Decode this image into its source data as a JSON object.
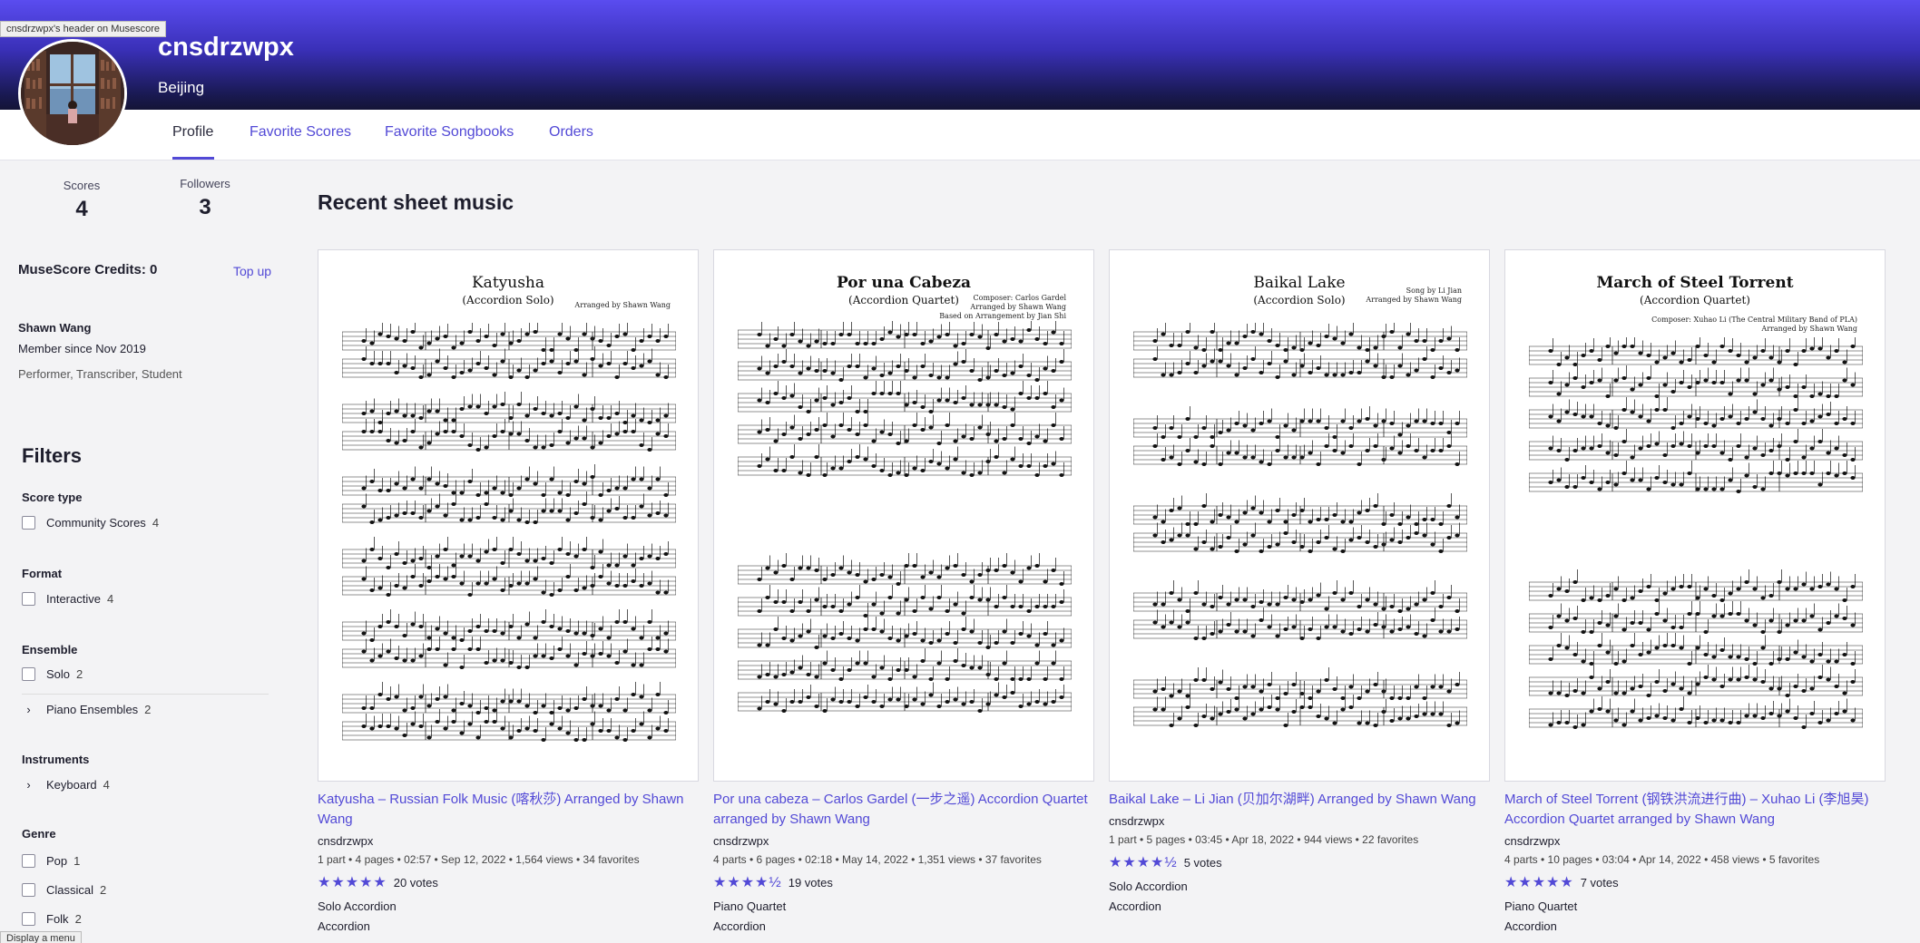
{
  "header": {
    "tooltip": "cnsdrzwpx's header on Musescore",
    "username": "cnsdrzwpx",
    "location": "Beijing"
  },
  "tabs": [
    {
      "label": "Profile"
    },
    {
      "label": "Favorite Scores"
    },
    {
      "label": "Favorite Songbooks"
    },
    {
      "label": "Orders"
    }
  ],
  "stats": {
    "scores_label": "Scores",
    "scores_value": "4",
    "followers_label": "Followers",
    "followers_value": "3"
  },
  "credits": {
    "label": "MuseScore Credits: 0",
    "topup": "Top up"
  },
  "profile": {
    "name": "Shawn Wang",
    "member_since": "Member since Nov 2019",
    "roles": "Performer, Transcriber, Student"
  },
  "filters": {
    "title": "Filters",
    "groups": [
      {
        "title": "Score type",
        "options": [
          {
            "label": "Community Scores",
            "count": "4"
          }
        ]
      },
      {
        "title": "Format",
        "options": [
          {
            "label": "Interactive",
            "count": "4"
          }
        ]
      },
      {
        "title": "Ensemble",
        "options": [
          {
            "label": "Solo",
            "count": "2"
          },
          {
            "label": "Piano Ensembles",
            "count": "2"
          }
        ]
      },
      {
        "title": "Instruments",
        "options": [
          {
            "label": "Keyboard",
            "count": "4"
          }
        ]
      },
      {
        "title": "Genre",
        "options": [
          {
            "label": "Pop",
            "count": "1"
          },
          {
            "label": "Classical",
            "count": "2"
          },
          {
            "label": "Folk",
            "count": "2"
          }
        ]
      }
    ]
  },
  "bottom_tip": "Display a menu",
  "main": {
    "title": "Recent sheet music",
    "cards": [
      {
        "sheet_title": "Katyusha",
        "sheet_sub": "(Accordion Solo)",
        "sheet_credit": "Arranged by Shawn Wang",
        "title": "Katyusha – Russian Folk Music (喀秋莎) Arranged by Shawn Wang",
        "author": "cnsdrzwpx",
        "meta": "1 part • 4 pages • 02:57 • Sep 12, 2022 • 1,564 views • 34 favorites",
        "stars": "★★★★★",
        "votes": "20 votes",
        "ensemble": "Solo Accordion",
        "instrument": "Accordion"
      },
      {
        "sheet_title": "Por una Cabeza",
        "sheet_sub": "(Accordion Quartet)",
        "sheet_credit": "Composer: Carlos Gardel\nArranged by Shawn Wang\nBased on Arrangement by Jian Shi",
        "title": "Por una cabeza – Carlos Gardel (一步之遥) Accordion Quartet arranged by Shawn Wang",
        "author": "cnsdrzwpx",
        "meta": "4 parts • 6 pages • 02:18 • May 14, 2022 • 1,351 views • 37 favorites",
        "stars": "★★★★½",
        "votes": "19 votes",
        "ensemble": "Piano Quartet",
        "instrument": "Accordion"
      },
      {
        "sheet_title": "Baikal Lake",
        "sheet_sub": "(Accordion Solo)",
        "sheet_credit": "Song by Li Jian\nArranged by Shawn Wang",
        "title": "Baikal Lake – Li Jian (贝加尔湖畔) Arranged by Shawn Wang",
        "author": "cnsdrzwpx",
        "meta": "1 part • 5 pages • 03:45 • Apr 18, 2022 • 944 views • 22 favorites",
        "stars": "★★★★½",
        "votes": "5 votes",
        "ensemble": "Solo Accordion",
        "instrument": "Accordion"
      },
      {
        "sheet_title": "March of Steel Torrent",
        "sheet_sub": "(Accordion Quartet)",
        "sheet_credit": "Composer: Xuhao Li (The Central Military Band of PLA)\nArranged by Shawn Wang",
        "title": "March of Steel Torrent (钢铁洪流进行曲) – Xuhao Li (李旭昊) Accordion Quartet arranged by Shawn Wang",
        "author": "cnsdrzwpx",
        "meta": "4 parts • 10 pages • 03:04 • Apr 14, 2022 • 458 views • 5 favorites",
        "stars": "★★★★★",
        "votes": "7 votes",
        "ensemble": "Piano Quartet",
        "instrument": "Accordion"
      }
    ]
  },
  "colors": {
    "accent": "#5249d6",
    "header_top": "#5a4cf0",
    "header_bottom": "#141436"
  }
}
